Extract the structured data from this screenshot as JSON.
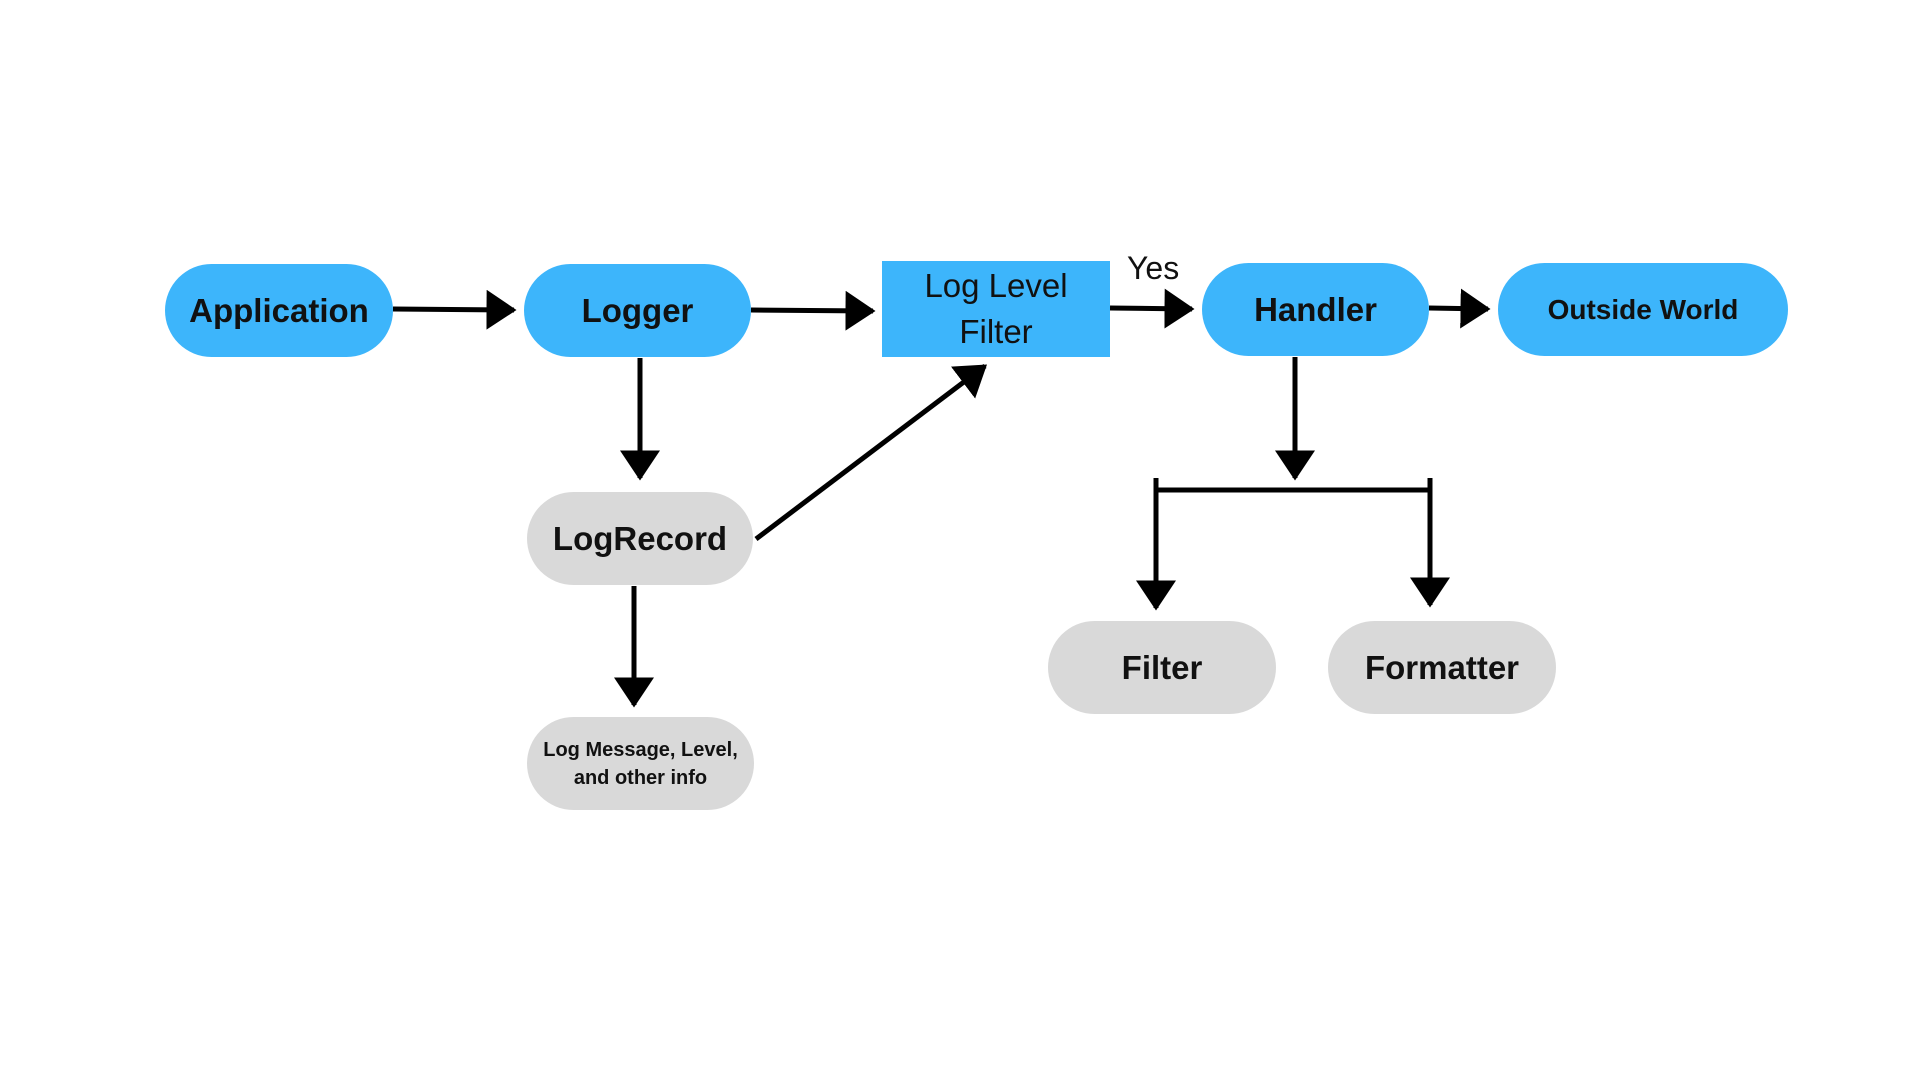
{
  "diagram": {
    "title": "",
    "colors": {
      "primary": "#3db5fb",
      "secondary": "#d9d9d9",
      "line": "#000000"
    },
    "nodes": [
      {
        "id": "application",
        "label": "Application",
        "style": "primary",
        "shape": "pill"
      },
      {
        "id": "logger",
        "label": "Logger",
        "style": "primary",
        "shape": "pill"
      },
      {
        "id": "log-level-filter",
        "label": "Log Level Filter",
        "style": "primary",
        "shape": "rect"
      },
      {
        "id": "handler",
        "label": "Handler",
        "style": "primary",
        "shape": "pill"
      },
      {
        "id": "outside-world",
        "label": "Outside World",
        "style": "primary",
        "shape": "pill"
      },
      {
        "id": "logrecord",
        "label": "LogRecord",
        "style": "secondary",
        "shape": "pill"
      },
      {
        "id": "log-message",
        "label": "Log Message, Level, and other info",
        "style": "secondary",
        "shape": "pill"
      },
      {
        "id": "filter",
        "label": "Filter",
        "style": "secondary",
        "shape": "pill"
      },
      {
        "id": "formatter",
        "label": "Formatter",
        "style": "secondary",
        "shape": "pill"
      }
    ],
    "edges": [
      {
        "from": "application",
        "to": "logger",
        "label": ""
      },
      {
        "from": "logger",
        "to": "log-level-filter",
        "label": ""
      },
      {
        "from": "log-level-filter",
        "to": "handler",
        "label": "Yes"
      },
      {
        "from": "handler",
        "to": "outside-world",
        "label": ""
      },
      {
        "from": "logger",
        "to": "logrecord",
        "label": ""
      },
      {
        "from": "logrecord",
        "to": "log-level-filter",
        "label": ""
      },
      {
        "from": "logrecord",
        "to": "log-message",
        "label": ""
      },
      {
        "from": "handler",
        "to": "filter",
        "label": ""
      },
      {
        "from": "handler",
        "to": "formatter",
        "label": ""
      }
    ],
    "text": {
      "application": "Application",
      "logger": "Logger",
      "llf_line1": "Log Level",
      "llf_line2": "Filter",
      "yes": "Yes",
      "handler": "Handler",
      "outside_world": "Outside World",
      "logrecord": "LogRecord",
      "logmsg_line1": "Log Message, Level,",
      "logmsg_line2": "and other info",
      "filter": "Filter",
      "formatter": "Formatter"
    }
  }
}
